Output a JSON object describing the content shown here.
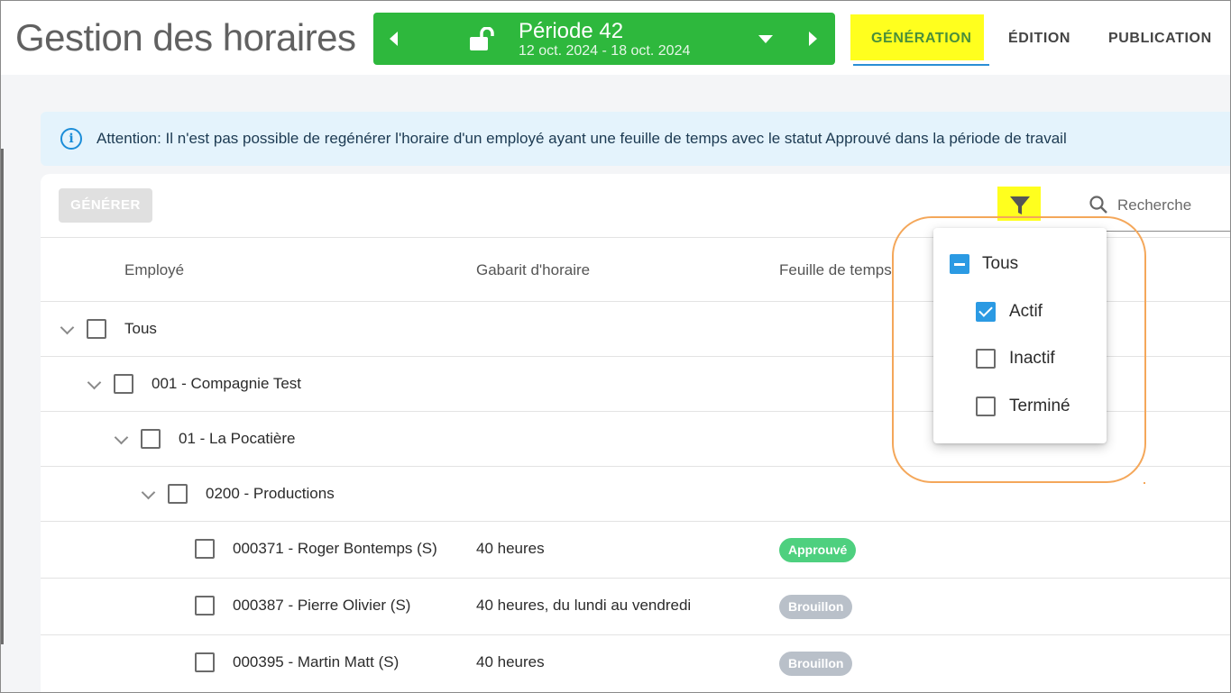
{
  "header": {
    "app_title": "Gestion des horaires",
    "period": {
      "title": "Période 42",
      "dates": "12 oct. 2024 - 18 oct. 2024"
    },
    "tabs": [
      {
        "label": "GÉNÉRATION",
        "active": true
      },
      {
        "label": "ÉDITION",
        "active": false
      },
      {
        "label": "PUBLICATION",
        "active": false
      }
    ]
  },
  "info_banner": {
    "text": "Attention: Il n'est pas possible de regénérer l'horaire d'un employé ayant une feuille de temps avec le statut Approuvé dans la période de travail"
  },
  "toolbar": {
    "generate_label": "GÉNÉRER",
    "search_placeholder": "Recherche"
  },
  "table": {
    "columns": [
      "Employé",
      "Gabarit d'horaire",
      "Feuille de temps"
    ],
    "tree_rows": [
      {
        "label": "Tous"
      },
      {
        "label": "001 - Compagnie Test"
      },
      {
        "label": "01 - La Pocatière"
      },
      {
        "label": "0200 - Productions"
      }
    ],
    "employees": [
      {
        "name": "000371 - Roger Bontemps (S)",
        "template": "40 heures",
        "status": "Approuvé"
      },
      {
        "name": "000387 - Pierre Olivier (S)",
        "template": "40 heures, du lundi au vendredi",
        "status": "Brouillon"
      },
      {
        "name": "000395 - Martin Matt (S)",
        "template": "40 heures",
        "status": "Brouillon"
      }
    ]
  },
  "filter_menu": {
    "items": [
      {
        "label": "Tous",
        "state": "indeterminate"
      },
      {
        "label": "Actif",
        "state": "checked"
      },
      {
        "label": "Inactif",
        "state": "unchecked"
      },
      {
        "label": "Terminé",
        "state": "unchecked"
      }
    ]
  },
  "colors": {
    "period_green": "#2eb83d",
    "accent_blue": "#2b9ae3",
    "highlight_yellow": "#ffff1e",
    "annotation_orange": "#f4a75a",
    "badge_approved": "#4ed07f",
    "badge_draft": "#b9c0c9"
  },
  "icons": [
    "chevron-left-icon",
    "unlock-icon",
    "chevron-down-icon",
    "chevron-right-icon",
    "info-icon",
    "filter-icon",
    "search-icon"
  ]
}
